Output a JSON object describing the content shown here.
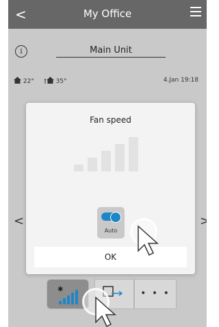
{
  "header": {
    "title": "My Office",
    "back_icon": "chevron-left-icon",
    "menu_icon": "hamburger-menu-icon"
  },
  "unit": {
    "name": "Main Unit",
    "info_icon": "info-icon"
  },
  "status": {
    "indoor_temp": "22°",
    "outdoor_temp": "35°",
    "datetime": "4.Jan 19:18",
    "indoor_icon": "house-icon",
    "outdoor_icon": "house-outdoor-icon"
  },
  "modal": {
    "title": "Fan speed",
    "fan_level_bars": 5,
    "auto_label": "Auto",
    "auto_enabled": true,
    "ok_label": "OK"
  },
  "bottom_tabs": [
    {
      "icon": "fan-speed-icon",
      "active": true
    },
    {
      "icon": "airflow-direction-icon",
      "active": false
    },
    {
      "label": "• • •",
      "icon": "more-icon",
      "active": false
    }
  ],
  "colors": {
    "accent": "#1e86c8",
    "topbar": "#676767",
    "overlay": "#c9c9c9"
  }
}
